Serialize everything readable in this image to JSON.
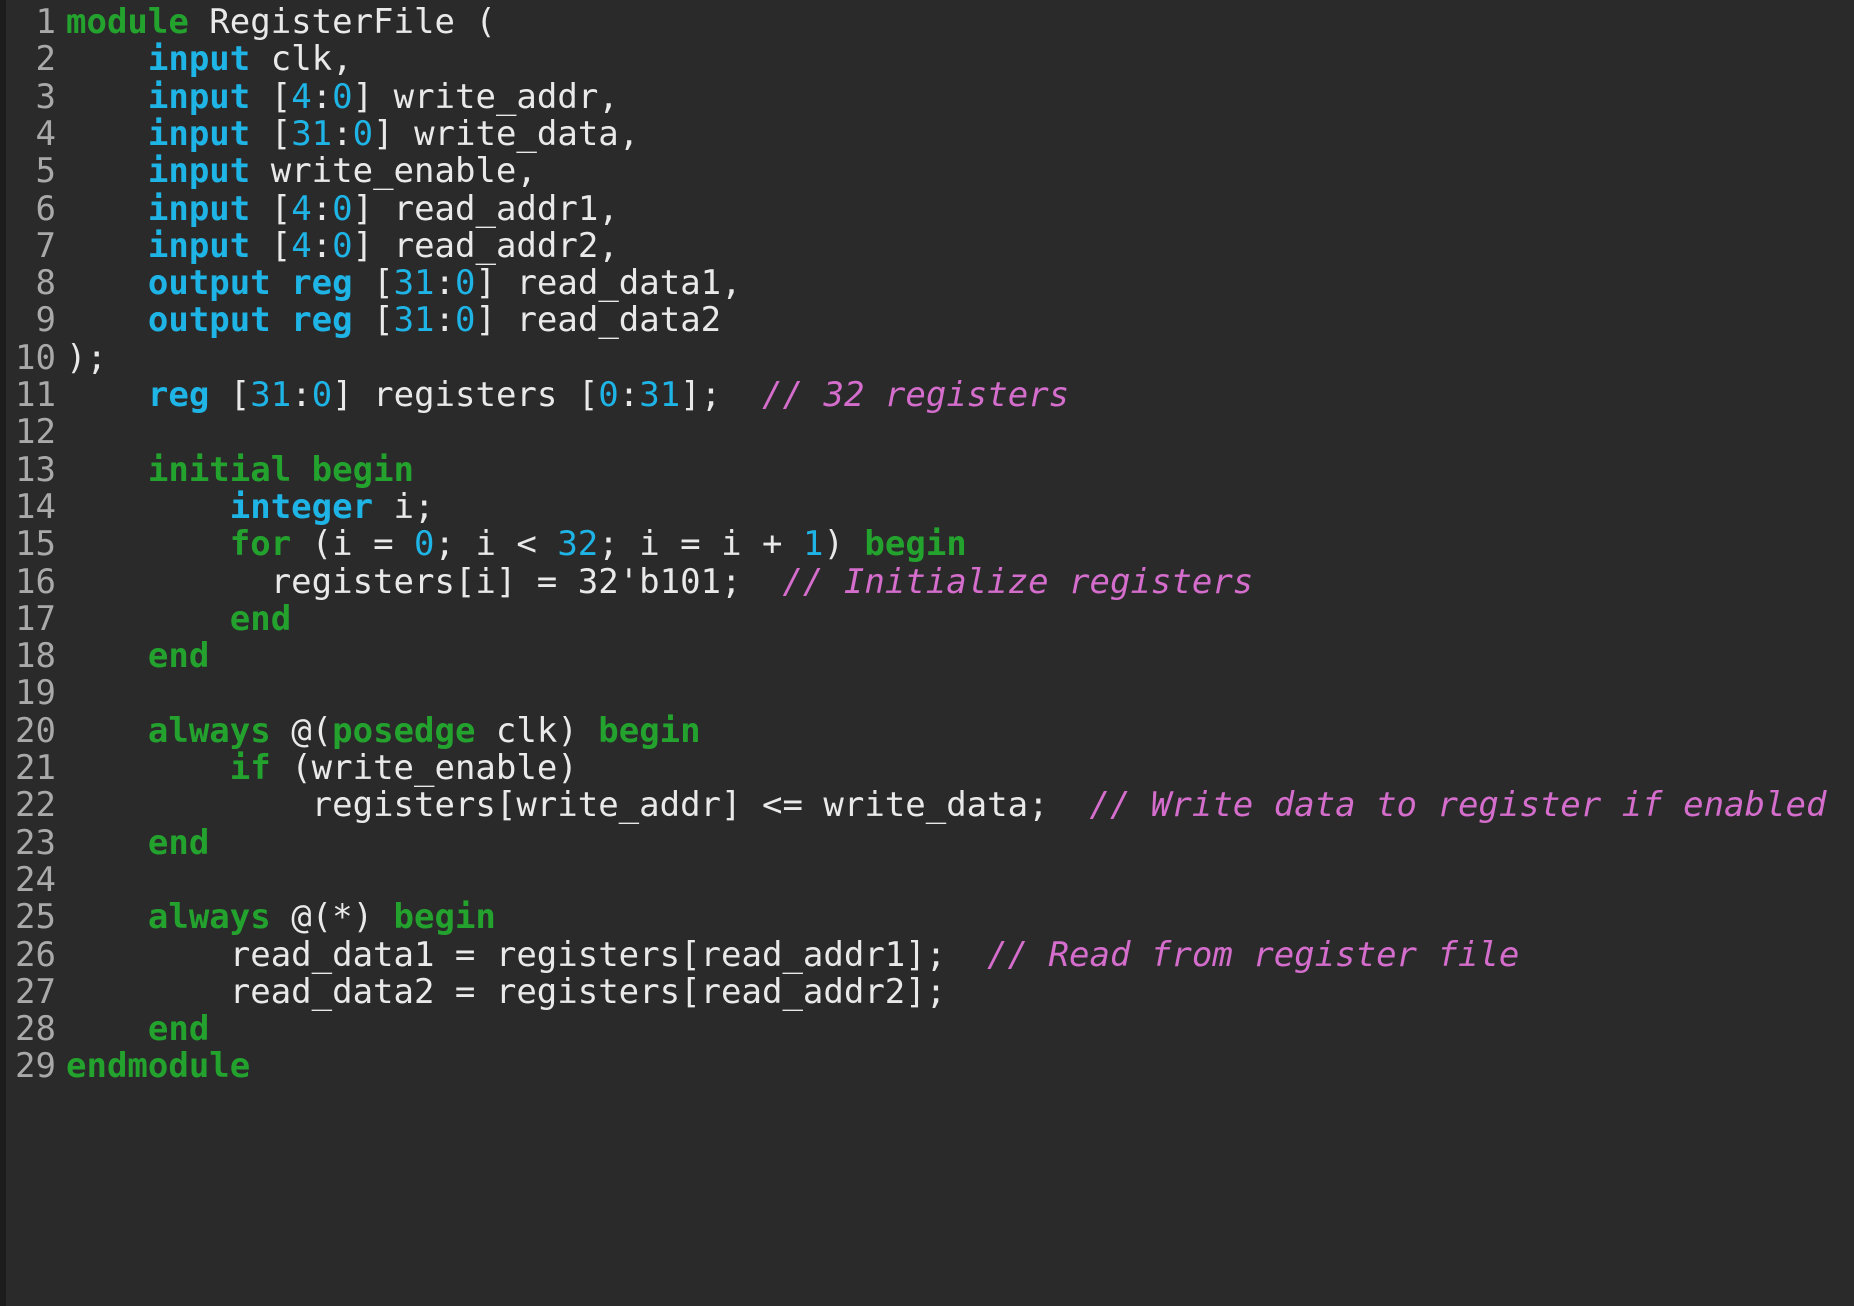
{
  "lines": [
    {
      "n": "1",
      "tokens": [
        {
          "t": "kg",
          "v": "module"
        },
        {
          "t": "p",
          "v": " RegisterFile ("
        }
      ]
    },
    {
      "n": "2",
      "tokens": [
        {
          "t": "p",
          "v": "    "
        },
        {
          "t": "kb",
          "v": "input"
        },
        {
          "t": "p",
          "v": " clk,"
        }
      ]
    },
    {
      "n": "3",
      "tokens": [
        {
          "t": "p",
          "v": "    "
        },
        {
          "t": "kb",
          "v": "input"
        },
        {
          "t": "p",
          "v": " ["
        },
        {
          "t": "num",
          "v": "4"
        },
        {
          "t": "p",
          "v": ":"
        },
        {
          "t": "num",
          "v": "0"
        },
        {
          "t": "p",
          "v": "] write_addr,"
        }
      ]
    },
    {
      "n": "4",
      "tokens": [
        {
          "t": "p",
          "v": "    "
        },
        {
          "t": "kb",
          "v": "input"
        },
        {
          "t": "p",
          "v": " ["
        },
        {
          "t": "num",
          "v": "31"
        },
        {
          "t": "p",
          "v": ":"
        },
        {
          "t": "num",
          "v": "0"
        },
        {
          "t": "p",
          "v": "] write_data,"
        }
      ]
    },
    {
      "n": "5",
      "tokens": [
        {
          "t": "p",
          "v": "    "
        },
        {
          "t": "kb",
          "v": "input"
        },
        {
          "t": "p",
          "v": " write_enable,"
        }
      ]
    },
    {
      "n": "6",
      "tokens": [
        {
          "t": "p",
          "v": "    "
        },
        {
          "t": "kb",
          "v": "input"
        },
        {
          "t": "p",
          "v": " ["
        },
        {
          "t": "num",
          "v": "4"
        },
        {
          "t": "p",
          "v": ":"
        },
        {
          "t": "num",
          "v": "0"
        },
        {
          "t": "p",
          "v": "] read_addr1,"
        }
      ]
    },
    {
      "n": "7",
      "tokens": [
        {
          "t": "p",
          "v": "    "
        },
        {
          "t": "kb",
          "v": "input"
        },
        {
          "t": "p",
          "v": " ["
        },
        {
          "t": "num",
          "v": "4"
        },
        {
          "t": "p",
          "v": ":"
        },
        {
          "t": "num",
          "v": "0"
        },
        {
          "t": "p",
          "v": "] read_addr2,"
        }
      ]
    },
    {
      "n": "8",
      "tokens": [
        {
          "t": "p",
          "v": "    "
        },
        {
          "t": "kb",
          "v": "output"
        },
        {
          "t": "p",
          "v": " "
        },
        {
          "t": "kb",
          "v": "reg"
        },
        {
          "t": "p",
          "v": " ["
        },
        {
          "t": "num",
          "v": "31"
        },
        {
          "t": "p",
          "v": ":"
        },
        {
          "t": "num",
          "v": "0"
        },
        {
          "t": "p",
          "v": "] read_data1,"
        }
      ]
    },
    {
      "n": "9",
      "tokens": [
        {
          "t": "p",
          "v": "    "
        },
        {
          "t": "kb",
          "v": "output"
        },
        {
          "t": "p",
          "v": " "
        },
        {
          "t": "kb",
          "v": "reg"
        },
        {
          "t": "p",
          "v": " ["
        },
        {
          "t": "num",
          "v": "31"
        },
        {
          "t": "p",
          "v": ":"
        },
        {
          "t": "num",
          "v": "0"
        },
        {
          "t": "p",
          "v": "] read_data2"
        }
      ]
    },
    {
      "n": "10",
      "tokens": [
        {
          "t": "p",
          "v": ");"
        }
      ]
    },
    {
      "n": "11",
      "tokens": [
        {
          "t": "p",
          "v": "    "
        },
        {
          "t": "kb",
          "v": "reg"
        },
        {
          "t": "p",
          "v": " ["
        },
        {
          "t": "num",
          "v": "31"
        },
        {
          "t": "p",
          "v": ":"
        },
        {
          "t": "num",
          "v": "0"
        },
        {
          "t": "p",
          "v": "] registers ["
        },
        {
          "t": "num",
          "v": "0"
        },
        {
          "t": "p",
          "v": ":"
        },
        {
          "t": "num",
          "v": "31"
        },
        {
          "t": "p",
          "v": "];  "
        },
        {
          "t": "cm",
          "v": "// 32 registers"
        }
      ]
    },
    {
      "n": "12",
      "tokens": []
    },
    {
      "n": "13",
      "tokens": [
        {
          "t": "p",
          "v": "    "
        },
        {
          "t": "kg",
          "v": "initial"
        },
        {
          "t": "p",
          "v": " "
        },
        {
          "t": "kg",
          "v": "begin"
        }
      ]
    },
    {
      "n": "14",
      "tokens": [
        {
          "t": "p",
          "v": "        "
        },
        {
          "t": "kb",
          "v": "integer"
        },
        {
          "t": "p",
          "v": " i;"
        }
      ]
    },
    {
      "n": "15",
      "tokens": [
        {
          "t": "p",
          "v": "        "
        },
        {
          "t": "kg",
          "v": "for"
        },
        {
          "t": "p",
          "v": " (i = "
        },
        {
          "t": "num",
          "v": "0"
        },
        {
          "t": "p",
          "v": "; i < "
        },
        {
          "t": "num",
          "v": "32"
        },
        {
          "t": "p",
          "v": "; i = i + "
        },
        {
          "t": "num",
          "v": "1"
        },
        {
          "t": "p",
          "v": ") "
        },
        {
          "t": "kg",
          "v": "begin"
        }
      ]
    },
    {
      "n": "16",
      "tokens": [
        {
          "t": "p",
          "v": "          registers[i] = 32'b101;  "
        },
        {
          "t": "cm",
          "v": "// Initialize registers"
        }
      ]
    },
    {
      "n": "17",
      "tokens": [
        {
          "t": "p",
          "v": "        "
        },
        {
          "t": "kg",
          "v": "end"
        }
      ]
    },
    {
      "n": "18",
      "tokens": [
        {
          "t": "p",
          "v": "    "
        },
        {
          "t": "kg",
          "v": "end"
        }
      ]
    },
    {
      "n": "19",
      "tokens": []
    },
    {
      "n": "20",
      "tokens": [
        {
          "t": "p",
          "v": "    "
        },
        {
          "t": "kg",
          "v": "always"
        },
        {
          "t": "p",
          "v": " @("
        },
        {
          "t": "kg",
          "v": "posedge"
        },
        {
          "t": "p",
          "v": " clk) "
        },
        {
          "t": "kg",
          "v": "begin"
        }
      ]
    },
    {
      "n": "21",
      "tokens": [
        {
          "t": "p",
          "v": "        "
        },
        {
          "t": "kg",
          "v": "if"
        },
        {
          "t": "p",
          "v": " (write_enable)"
        }
      ]
    },
    {
      "n": "22",
      "tokens": [
        {
          "t": "p",
          "v": "            registers[write_addr] <= write_data;  "
        },
        {
          "t": "cm",
          "v": "// Write data to register if enabled"
        }
      ]
    },
    {
      "n": "23",
      "tokens": [
        {
          "t": "p",
          "v": "    "
        },
        {
          "t": "kg",
          "v": "end"
        }
      ]
    },
    {
      "n": "24",
      "tokens": []
    },
    {
      "n": "25",
      "tokens": [
        {
          "t": "p",
          "v": "    "
        },
        {
          "t": "kg",
          "v": "always"
        },
        {
          "t": "p",
          "v": " @(*) "
        },
        {
          "t": "kg",
          "v": "begin"
        }
      ]
    },
    {
      "n": "26",
      "tokens": [
        {
          "t": "p",
          "v": "        read_data1 = registers[read_addr1];  "
        },
        {
          "t": "cm",
          "v": "// Read from register file"
        }
      ]
    },
    {
      "n": "27",
      "tokens": [
        {
          "t": "p",
          "v": "        read_data2 = registers[read_addr2];"
        }
      ]
    },
    {
      "n": "28",
      "tokens": [
        {
          "t": "p",
          "v": "    "
        },
        {
          "t": "kg",
          "v": "end"
        }
      ]
    },
    {
      "n": "29",
      "tokens": [
        {
          "t": "kg",
          "v": "endmodule"
        }
      ]
    }
  ]
}
